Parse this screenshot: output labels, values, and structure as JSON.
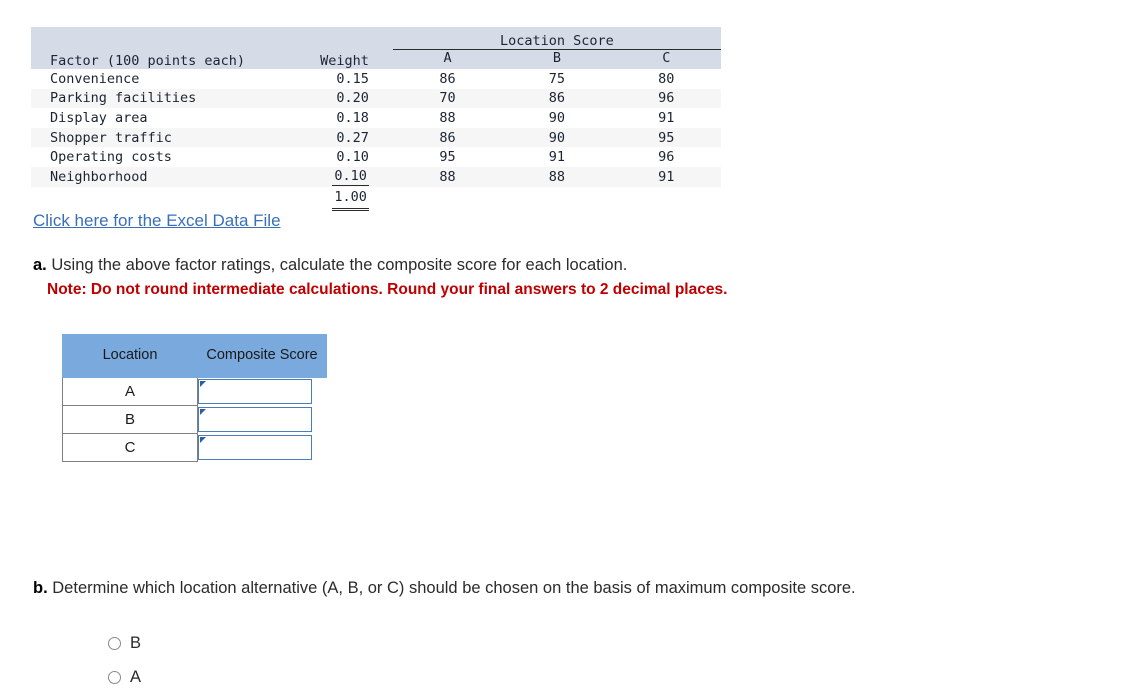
{
  "factor_table": {
    "col_factor_header": "Factor (100 points each)",
    "col_weight_header": "Weight",
    "span_header": "Location Score",
    "score_headers": [
      "A",
      "B",
      "C"
    ],
    "rows": [
      {
        "factor": "Convenience",
        "weight": "0.15",
        "a": "86",
        "b": "75",
        "c": "80"
      },
      {
        "factor": "Parking facilities",
        "weight": "0.20",
        "a": "70",
        "b": "86",
        "c": "96"
      },
      {
        "factor": "Display area",
        "weight": "0.18",
        "a": "88",
        "b": "90",
        "c": "91"
      },
      {
        "factor": "Shopper traffic",
        "weight": "0.27",
        "a": "86",
        "b": "90",
        "c": "95"
      },
      {
        "factor": "Operating costs",
        "weight": "0.10",
        "a": "95",
        "b": "91",
        "c": "96"
      },
      {
        "factor": "Neighborhood",
        "weight": "0.10",
        "a": "88",
        "b": "88",
        "c": "91"
      }
    ],
    "weight_total": "1.00"
  },
  "excel_link": {
    "label": "Click here for the Excel Data File"
  },
  "question_a": {
    "label": "a.",
    "text": "Using the above factor ratings, calculate the composite score for each location.",
    "note": "Note: Do not round intermediate calculations. Round your final answers to 2 decimal places."
  },
  "answer_table": {
    "headers": {
      "location": "Location",
      "composite_score": "Composite Score"
    },
    "rows": [
      {
        "location": "A",
        "composite_score": ""
      },
      {
        "location": "B",
        "composite_score": ""
      },
      {
        "location": "C",
        "composite_score": ""
      }
    ]
  },
  "question_b": {
    "label": "b.",
    "text": "Determine which location alternative (A, B, or C) should be chosen on the basis of maximum composite score.",
    "options": [
      {
        "label": "B",
        "selected": false
      },
      {
        "label": "A",
        "selected": false
      }
    ]
  },
  "colors": {
    "header_band": "#d6dce7",
    "answer_header_blue": "#7aa9de",
    "input_border_blue": "#4a7ebb",
    "link_blue": "#3a6fb8",
    "note_red": "#c00000"
  }
}
